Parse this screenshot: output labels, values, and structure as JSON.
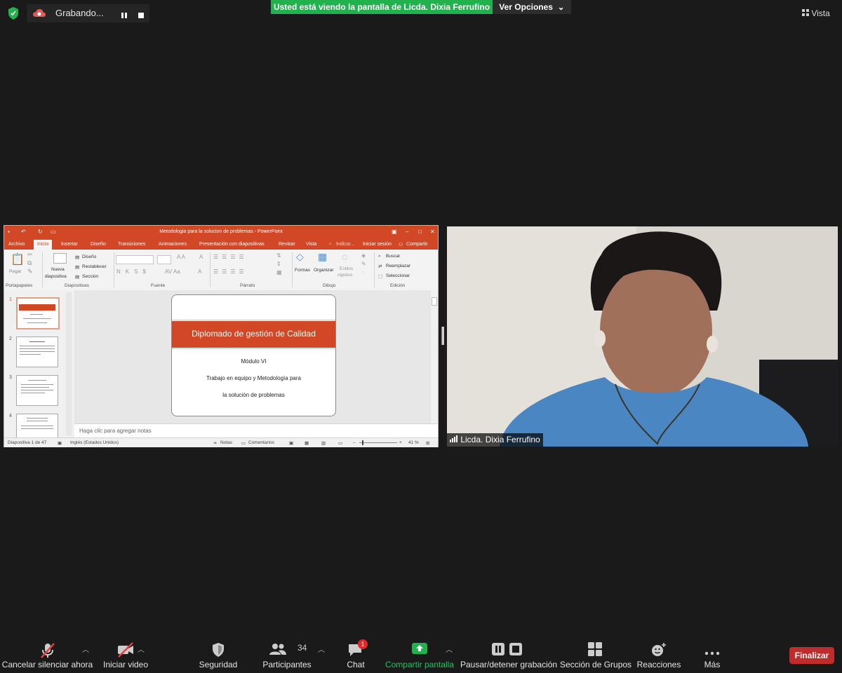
{
  "recording": {
    "label": "Grabando..."
  },
  "share_banner": "Usted está viendo la pantalla de Licda. Dixia Ferrufino",
  "view_options": "Ver Opciones",
  "view_button": "Vista",
  "ppt": {
    "window_title": "Metodologia para la solucion de problemas - PowerPoint",
    "tabs": [
      "Archivo",
      "Inicio",
      "Insertar",
      "Diseño",
      "Transiciones",
      "Animaciones",
      "Presentación con diapositivas",
      "Revisar",
      "Vista"
    ],
    "tell_me": "Indicar...",
    "sign_in": "Iniciar sesión",
    "share": "Compartir",
    "ribbon": {
      "paste": "Pegar",
      "new_slide_1": "Nueva",
      "new_slide_2": "diapositiva",
      "design": "Diseño",
      "reset": "Restablecer",
      "section": "Sección",
      "shapes": "Formas",
      "arrange": "Organizar",
      "quick_styles_1": "Estilos",
      "quick_styles_2": "rápidos",
      "find": "Buscar",
      "replace": "Reemplazar",
      "select": "Seleccionar",
      "group_labels": [
        "Portapapeles",
        "Diapositivas",
        "Fuente",
        "Párrafo",
        "Dibujo",
        "Edición"
      ]
    },
    "thumbnail_numbers": [
      "1",
      "2",
      "3",
      "4"
    ],
    "slide": {
      "title": "Diplomado de gestión de Calidad",
      "line1": "Módulo VI",
      "line2": "Trabajo en equipo y Metodología para",
      "line3": "la solución de problemas"
    },
    "notes_placeholder": "Haga clic para agregar notas",
    "status": {
      "slide_counter": "Diapositiva 1 de 47",
      "language": "Inglés (Estados Unidos)",
      "notes": "Notas",
      "comments": "Comentarios",
      "zoom": "41 %"
    }
  },
  "video": {
    "participant_name": "Licda. Dixia Ferrufino"
  },
  "toolbar": {
    "unmute": "Cancelar silenciar ahora",
    "start_video": "Iniciar video",
    "security": "Seguridad",
    "participants": "Participantes",
    "participants_count": "34",
    "chat": "Chat",
    "chat_badge": "1",
    "share_screen": "Compartir pantalla",
    "pause_recording": "Pausar/detener grabación",
    "breakout": "Sección de Grupos",
    "reactions": "Reacciones",
    "more": "Más",
    "end": "Finalizar"
  },
  "colors": {
    "share_green": "#21b24e",
    "ppt_orange": "#d24726",
    "end_red": "#c02b2b"
  }
}
